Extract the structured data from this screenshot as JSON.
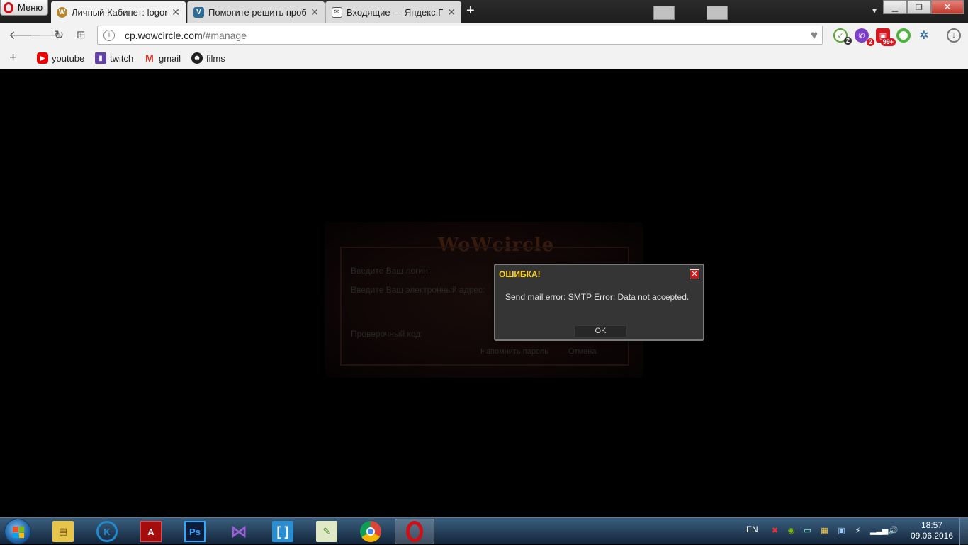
{
  "browser": {
    "menu_label": "Меню",
    "tabs": [
      {
        "title": "Личный Кабинет: logon.wowcircle.com",
        "favicon": "wow-icon"
      },
      {
        "title": "Помогите решить проблему",
        "favicon": "v-icon"
      },
      {
        "title": "Входящие — Яндекс.Почта",
        "favicon": "mail-icon"
      }
    ],
    "address_host": "cp.wowcircle.com",
    "address_path": "/#manage",
    "extensions": [
      {
        "name": "shield-check-icon",
        "badge": "2"
      },
      {
        "name": "viber-icon",
        "badge": "2"
      },
      {
        "name": "gift-icon",
        "badge": "99+"
      },
      {
        "name": "green-circle-icon",
        "badge": ""
      },
      {
        "name": "network-icon",
        "badge": ""
      }
    ],
    "bookmarks": [
      {
        "label": "youtube",
        "icon": "youtube-icon"
      },
      {
        "label": "twitch",
        "icon": "twitch-icon"
      },
      {
        "label": "gmail",
        "icon": "gmail-icon"
      },
      {
        "label": "films",
        "icon": "films-icon"
      }
    ]
  },
  "page": {
    "logo_text": "WoWcircle",
    "login_label": "Введите Ваш логин:",
    "email_label": "Введите Ваш электронный адрес:",
    "code_label": "Проверочный код:",
    "remind_button": "Напомнить пароль",
    "cancel_button": "Отмена"
  },
  "dialog": {
    "title": "ОШИБКА!",
    "message": "Send mail error: SMTP Error: Data not accepted.",
    "ok_label": "OK"
  },
  "taskbar": {
    "apps": [
      "explorer",
      "kodi",
      "acrobat",
      "photoshop",
      "visual-studio",
      "brackets",
      "notepad-plus-plus",
      "chrome",
      "opera"
    ],
    "language": "EN",
    "time": "18:57",
    "date": "09.06.2016"
  },
  "colors": {
    "dialog_title": "#ffd21f",
    "dialog_bg": "#353535",
    "opera_red": "#cc1016"
  }
}
